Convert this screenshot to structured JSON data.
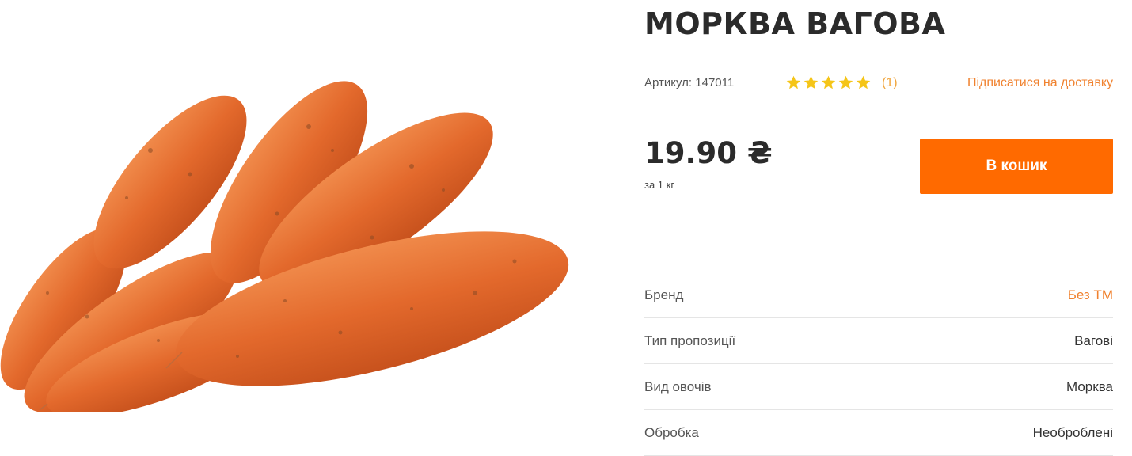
{
  "product": {
    "title": "МОРКВА ВАГОВА",
    "sku_text": "Артикул: 147011",
    "rating_stars": 5,
    "review_count": "(1)",
    "subscribe_label": "Підписатися на доставку",
    "price": "19.90 ₴",
    "price_unit": "за 1 кг",
    "cart_label": "В кошик",
    "image": "carrot-bunch-photo"
  },
  "specs": [
    {
      "label": "Бренд",
      "value": "Без ТМ"
    },
    {
      "label": "Тип пропозиції",
      "value": "Вагові"
    },
    {
      "label": "Вид овочів",
      "value": "Морква"
    },
    {
      "label": "Обробка",
      "value": "Необроблені"
    }
  ],
  "colors": {
    "accent": "#ff6a00",
    "link": "#f0822f",
    "star": "#f5c518",
    "carrot": "#e8743a"
  }
}
